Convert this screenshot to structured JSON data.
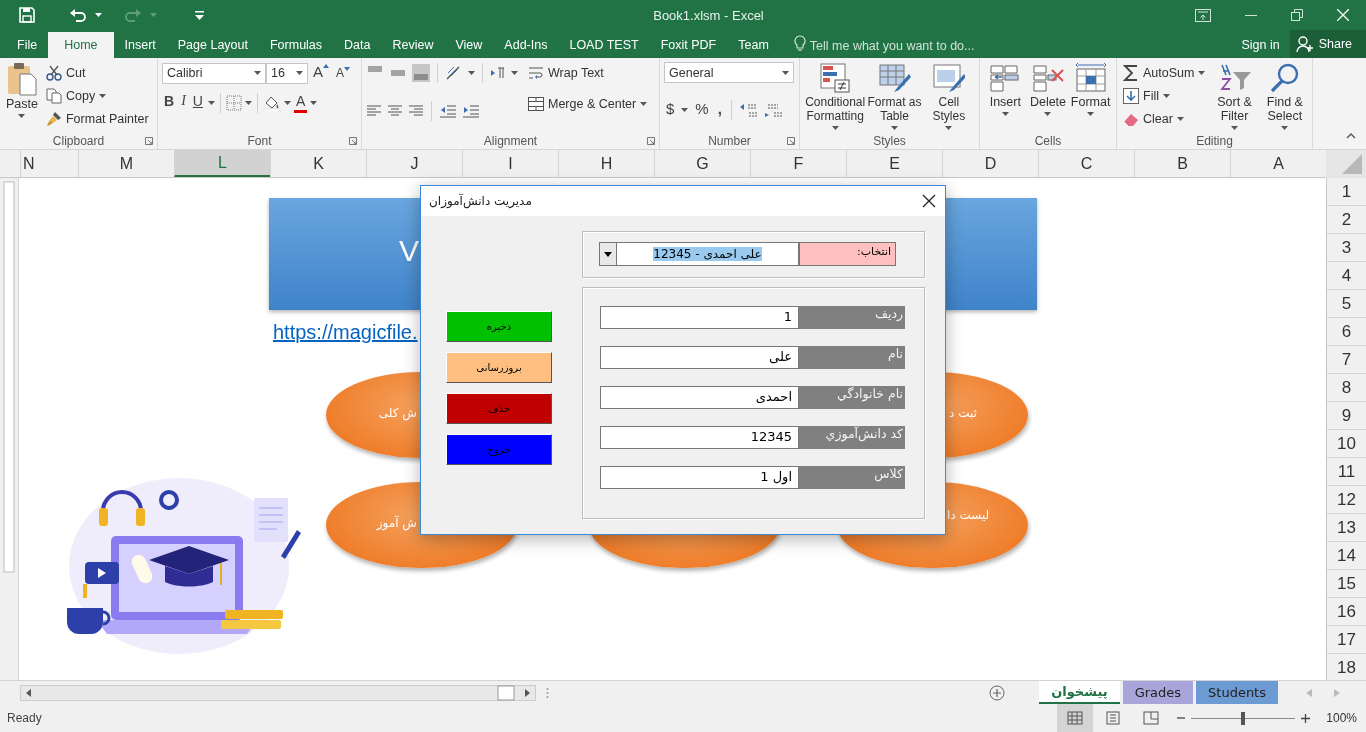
{
  "window": {
    "title": "Book1.xlsm - Excel"
  },
  "ribbon_tabs": [
    {
      "label": "File",
      "selected": false
    },
    {
      "label": "Home",
      "selected": true
    },
    {
      "label": "Insert",
      "selected": false
    },
    {
      "label": "Page Layout",
      "selected": false
    },
    {
      "label": "Formulas",
      "selected": false
    },
    {
      "label": "Data",
      "selected": false
    },
    {
      "label": "Review",
      "selected": false
    },
    {
      "label": "View",
      "selected": false
    },
    {
      "label": "Add-Ins",
      "selected": false
    },
    {
      "label": "LOAD TEST",
      "selected": false
    },
    {
      "label": "Foxit PDF",
      "selected": false
    },
    {
      "label": "Team",
      "selected": false
    }
  ],
  "tell_me": {
    "placeholder": "Tell me what you want to do..."
  },
  "account": {
    "sign_in": "Sign in",
    "share": "Share"
  },
  "clipboard": {
    "label": "Clipboard",
    "paste": "Paste",
    "cut": "Cut",
    "copy": "Copy",
    "format_painter": "Format Painter"
  },
  "font": {
    "label": "Font",
    "font_name": "Calibri",
    "font_size": "16",
    "grow": "A",
    "shrink": "A",
    "bold": "B",
    "italic": "I",
    "underline": "U",
    "font_color": "A"
  },
  "alignment": {
    "label": "Alignment",
    "vertical_align": [
      {
        "selected": false
      },
      {
        "selected": false
      },
      {
        "selected": true
      }
    ],
    "wrap_text": "Wrap Text",
    "merge": "Merge & Center"
  },
  "number": {
    "label": "Number",
    "format": "General",
    "currency": "$",
    "percent": "%",
    "comma": ","
  },
  "styles": {
    "label": "Styles",
    "buttons": [
      "Conditional\nFormatting",
      "Format as\nTable",
      "Cell\nStyles"
    ]
  },
  "cells": {
    "label": "Cells",
    "buttons": [
      "Insert",
      "Delete",
      "Format"
    ]
  },
  "editing": {
    "label": "Editing",
    "autosum": "AutoSum",
    "fill": "Fill",
    "clear": "Clear",
    "sort_filter": "Sort &\nFilter",
    "find_select": "Find &\nSelect"
  },
  "sheet": {
    "columns": [
      {
        "label": "N",
        "selected": false
      },
      {
        "label": "M",
        "selected": false
      },
      {
        "label": "L",
        "selected": true
      },
      {
        "label": "K",
        "selected": false
      },
      {
        "label": "J",
        "selected": false
      },
      {
        "label": "I",
        "selected": false
      },
      {
        "label": "H",
        "selected": false
      },
      {
        "label": "G",
        "selected": false
      },
      {
        "label": "F",
        "selected": false
      },
      {
        "label": "E",
        "selected": false
      },
      {
        "label": "D",
        "selected": false
      },
      {
        "label": "C",
        "selected": false
      },
      {
        "label": "B",
        "selected": false
      },
      {
        "label": "A",
        "selected": false
      }
    ],
    "rows": [
      "1",
      "2",
      "3",
      "4",
      "5",
      "6",
      "7",
      "8",
      "9",
      "10",
      "11",
      "12",
      "13",
      "14",
      "15",
      "16",
      "17",
      "18"
    ],
    "banner_text": "V",
    "link": "https://magicfile.",
    "shapes": [
      {
        "kind": "oval",
        "text": "ش کلی"
      },
      {
        "kind": "oval",
        "text": "ثبت د"
      },
      {
        "kind": "oval",
        "text": "ش آموز"
      },
      {
        "kind": "oval"
      },
      {
        "kind": "oval",
        "text": "لیست دا"
      }
    ]
  },
  "dialog": {
    "title": "مدیریت دانش‌آموزان",
    "actions": [
      {
        "label": "ذخیره",
        "color": "#00c000"
      },
      {
        "label": "بروزرسانی",
        "color": "#ffbf80"
      },
      {
        "label": "حذف",
        "color": "#c00000"
      },
      {
        "label": "خروج",
        "color": "#0000ff"
      }
    ],
    "selector": {
      "label": "انتخاب:",
      "value": "علی احمدی - 12345"
    },
    "fields": [
      {
        "label": "ردیف",
        "value": "1"
      },
      {
        "label": "نام",
        "value": "علی"
      },
      {
        "label": "نام خانوادگي",
        "value": "احمدی"
      },
      {
        "label": "کد دانش‌آموزي",
        "value": "12345"
      },
      {
        "label": "کلاس",
        "value": "اول 1"
      }
    ]
  },
  "sheet_tabs": [
    {
      "label": "پیشخوان",
      "selected": true
    },
    {
      "label": "Grades",
      "selected": false,
      "color": "#a9a4d9"
    },
    {
      "label": "Students",
      "selected": false,
      "color": "#6b9bd2"
    }
  ],
  "status_bar": {
    "text": "Ready",
    "views": [
      {
        "selected": true
      },
      {
        "selected": false
      },
      {
        "selected": false
      }
    ],
    "zoom": {
      "level": 0.5,
      "reading": "100%"
    }
  }
}
